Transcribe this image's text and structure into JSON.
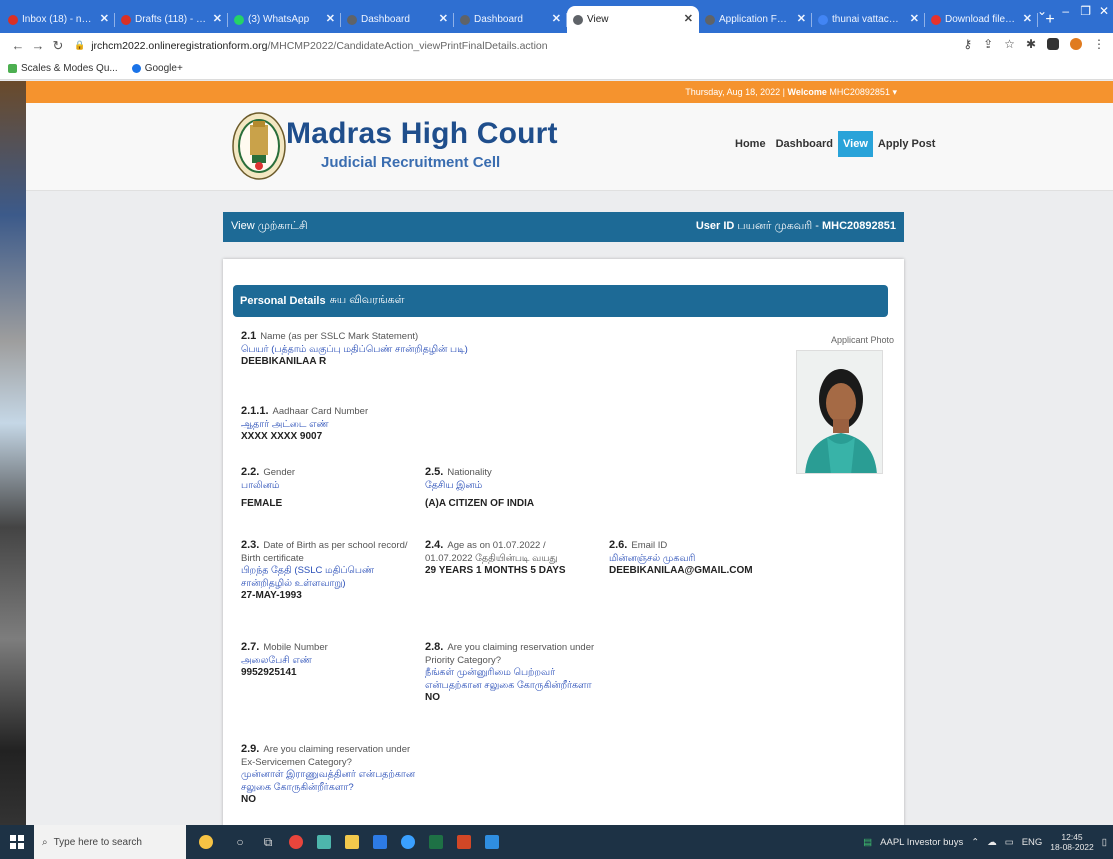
{
  "browser": {
    "tabs": [
      {
        "label": "Inbox (18) - niepmd",
        "favicon_color": "#d93025"
      },
      {
        "label": "Drafts (118) - niepmd",
        "favicon_color": "#d93025"
      },
      {
        "label": "(3) WhatsApp",
        "favicon_color": "#25d366"
      },
      {
        "label": "Dashboard",
        "favicon_color": "#5f6368"
      },
      {
        "label": "Dashboard",
        "favicon_color": "#5f6368"
      },
      {
        "label": "View",
        "favicon_color": "#5f6368",
        "active": true
      },
      {
        "label": "Application Form (4)",
        "favicon_color": "#5f6368"
      },
      {
        "label": "thunai vattachiyar in",
        "favicon_color": "#4285f4"
      },
      {
        "label": "Download file | iLove",
        "favicon_color": "#e5322d"
      }
    ],
    "new_tab_icon": "+",
    "url_host": "jrchcm2022.onlineregistrationform.org",
    "url_path": "/MHCMP2022/CandidateAction_viewPrintFinalDetails.action",
    "bookmarks": [
      {
        "label": "Scales & Modes Qu...",
        "icon_color": "#4caf50"
      },
      {
        "label": "Google+",
        "icon_color": "#1a73e8"
      }
    ]
  },
  "site": {
    "top_bar": {
      "date": "Thursday, Aug 18, 2022",
      "sep": "|",
      "welcome_label": "Welcome",
      "user": "MHC20892851",
      "caret": "▾"
    },
    "brand": {
      "title": "Madras High Court",
      "subtitle": "Judicial Recruitment Cell"
    },
    "nav": [
      {
        "label": "Home"
      },
      {
        "label": "Dashboard"
      },
      {
        "label": "View",
        "active": true
      },
      {
        "label": "Apply Post"
      }
    ],
    "view_bar": {
      "left": "View முற்காட்சி",
      "user_id_label": "User ID",
      "user_id_tamil": "பயனர் முகவரி -",
      "user_id_value": "MHC20892851"
    },
    "section": {
      "title": "Personal Details",
      "title_tamil": "சுய விவரங்கள்"
    },
    "photo_label": "Applicant Photo",
    "fields": {
      "name": {
        "num": "2.1",
        "label": "Name (as per SSLC Mark Statement)",
        "tamil": "பெயர் (பத்தாம் வகுப்பு மதிப்பெண் சான்றிதழின் படி)",
        "value": "DEEBIKANILAA R"
      },
      "aadhaar": {
        "num": "2.1.1.",
        "label": "Aadhaar Card Number",
        "tamil": "ஆதார் அட்டை எண்",
        "value": "XXXX XXXX 9007"
      },
      "gender": {
        "num": "2.2.",
        "label": "Gender",
        "tamil": "பாலினம்",
        "value": "FEMALE"
      },
      "nationality": {
        "num": "2.5.",
        "label": "Nationality",
        "tamil": "தேசிய இனம்",
        "value": "(A)A CITIZEN OF INDIA"
      },
      "dob": {
        "num": "2.3.",
        "label": "Date of Birth as per school record/ Birth certificate",
        "tamil": "பிறந்த தேதி (SSLC மதிப்பெண் சான்றிதழில் உள்ளவாறு)",
        "value": "27-MAY-1993"
      },
      "age": {
        "num": "2.4.",
        "label": "Age as on 01.07.2022 /",
        "label2": "01.07.2022 தேதியின்படி வயது",
        "value": "29 YEARS 1 MONTHS 5 DAYS"
      },
      "email": {
        "num": "2.6.",
        "label": "Email ID",
        "tamil": "மின்னஞ்சல் முகவரி",
        "value": "DEEBIKANILAA@GMAIL.COM"
      },
      "mobile": {
        "num": "2.7.",
        "label": "Mobile Number",
        "tamil": "அலைபேசி எண்",
        "value": "9952925141"
      },
      "priority": {
        "num": "2.8.",
        "label": "Are you claiming reservation under Priority Category?",
        "tamil": "நீங்கள் முன்னுரிமை பெற்றவர் என்பதற்கான சலுகை கோருகின்றீர்களா",
        "value": "NO"
      },
      "ex_service": {
        "num": "2.9.",
        "label": "Are you claiming reservation under Ex-Servicemen Category?",
        "tamil": "முன்னாள் இராணுவத்தினர் என்பதற்கான சலுகை கோருகின்றீர்களா?",
        "value": "NO"
      }
    }
  },
  "taskbar": {
    "search_placeholder": "Type here to search",
    "stock": "AAPL  Investor buys",
    "lang": "ENG",
    "time": "12:45",
    "date": "18-08-2022"
  }
}
